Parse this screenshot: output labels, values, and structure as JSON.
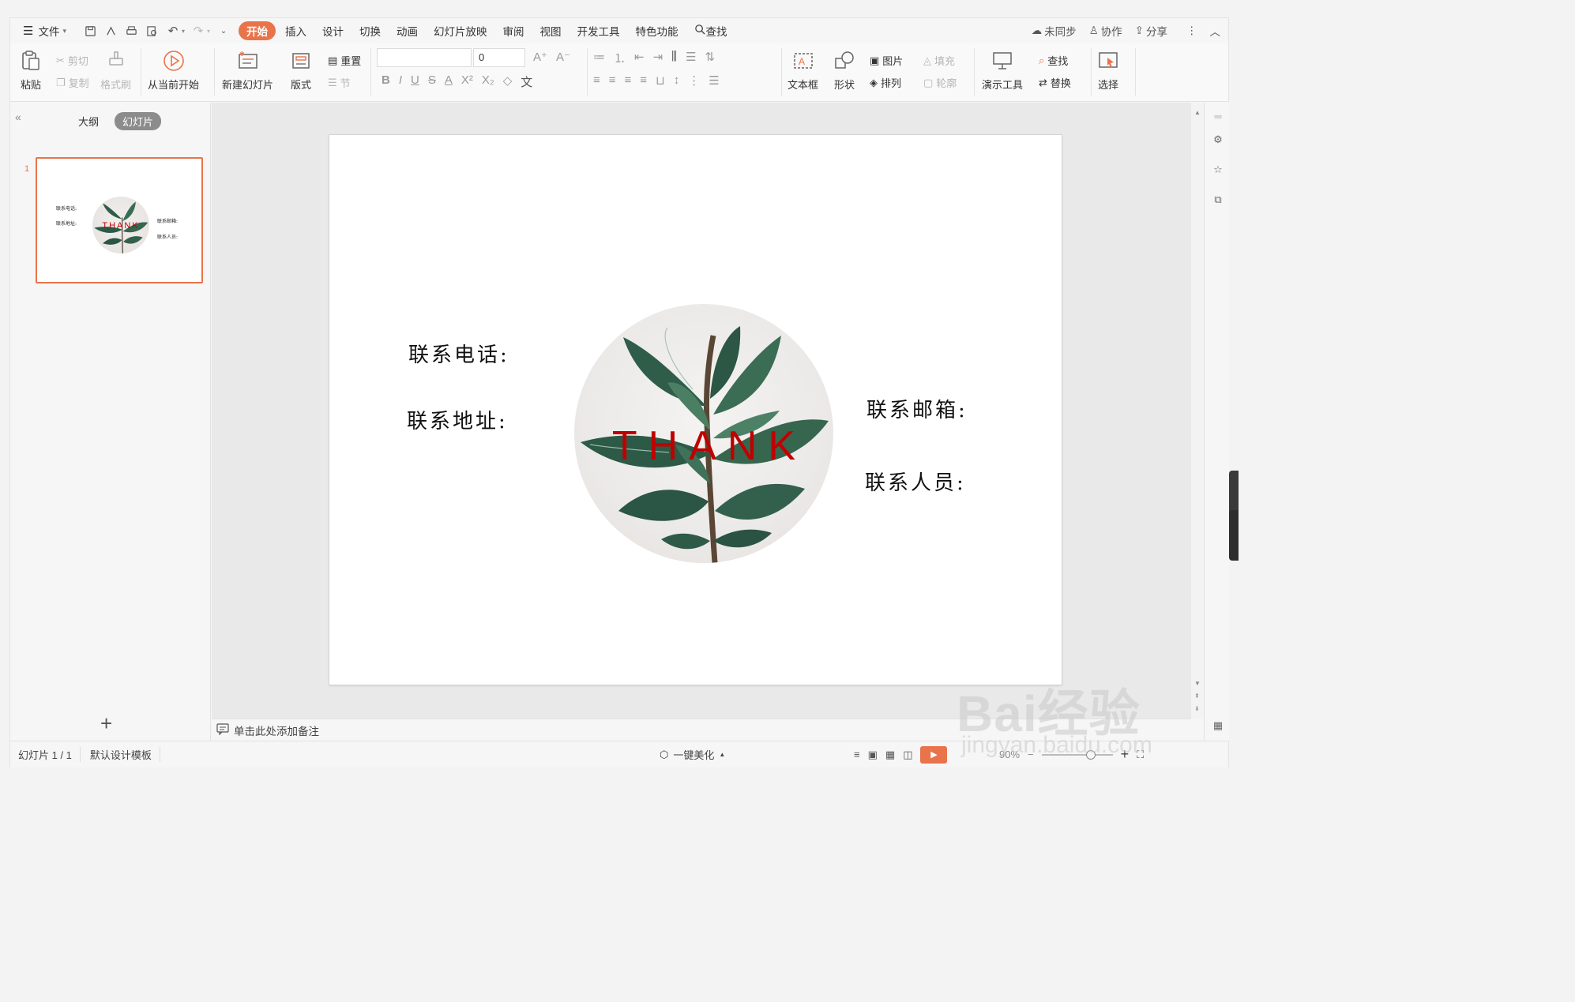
{
  "menubar": {
    "file": "文件",
    "tabs": [
      "开始",
      "插入",
      "设计",
      "切换",
      "动画",
      "幻灯片放映",
      "审阅",
      "视图",
      "开发工具",
      "特色功能"
    ],
    "search": "查找",
    "sync": "未同步",
    "collab": "协作",
    "share": "分享"
  },
  "ribbon": {
    "paste": "粘贴",
    "cut": "剪切",
    "copy": "复制",
    "format_painter": "格式刷",
    "from_current": "从当前开始",
    "new_slide": "新建幻灯片",
    "layout": "版式",
    "reset": "重置",
    "section": "节",
    "font_size_value": "0",
    "textbox": "文本框",
    "shape": "形状",
    "picture": "图片",
    "arrange": "排列",
    "fill": "填充",
    "outline": "轮廓",
    "present_tools": "演示工具",
    "find": "查找",
    "replace": "替换",
    "select": "选择"
  },
  "leftpane": {
    "tab_outline": "大纲",
    "tab_slides": "幻灯片",
    "slide_number": "1",
    "add": "+"
  },
  "slide": {
    "phone": "联系电话:",
    "address": "联系地址:",
    "email": "联系邮箱:",
    "contact": "联系人员:",
    "thank": "THANK"
  },
  "notes": {
    "placeholder": "单击此处添加备注"
  },
  "status": {
    "slide_count": "幻灯片 1 / 1",
    "template": "默认设计模板",
    "beautify": "一键美化",
    "zoom": "90%"
  },
  "watermark": {
    "brand": "Bai经验",
    "url": "jingyan.baidu.com"
  },
  "colors": {
    "accent": "#e9734a",
    "thank_red": "#c00000"
  }
}
